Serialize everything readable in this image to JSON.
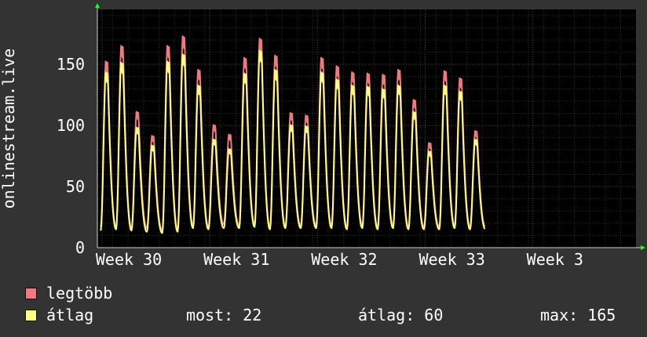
{
  "chart_data": {
    "type": "line",
    "ylabel": "onlinestream.live",
    "ylim": [
      0,
      195
    ],
    "yticks": [
      0,
      50,
      100,
      150
    ],
    "x_tick_labels": [
      "Week 30",
      "Week 31",
      "Week 32",
      "Week 33",
      "Week 3"
    ],
    "x_range_days": [
      0,
      35
    ],
    "grid": true,
    "series": [
      {
        "name": "legtöbb",
        "color": "#f07880",
        "daily_peaks": [
          155,
          168,
          113,
          93,
          168,
          176,
          148,
          102,
          94,
          158,
          174,
          160,
          112,
          110,
          158,
          151,
          146,
          145,
          144,
          148,
          123,
          87,
          147,
          141,
          97
        ],
        "daily_troughs": [
          17,
          17,
          16,
          16,
          14,
          15,
          18,
          17,
          19,
          18,
          19,
          17,
          18,
          18,
          18,
          18,
          17,
          18,
          17,
          18,
          17,
          17,
          17,
          18,
          17
        ]
      },
      {
        "name": "átlag",
        "color": "#ffff80",
        "daily_peaks": [
          146,
          154,
          100,
          85,
          155,
          161,
          135,
          90,
          82,
          145,
          164,
          148,
          102,
          101,
          146,
          140,
          135,
          134,
          132,
          135,
          113,
          80,
          135,
          130,
          90
        ],
        "daily_troughs": [
          14,
          15,
          14,
          13,
          12,
          13,
          16,
          15,
          16,
          16,
          17,
          15,
          16,
          16,
          16,
          16,
          15,
          16,
          15,
          16,
          15,
          15,
          15,
          16,
          15
        ]
      }
    ]
  },
  "legend": {
    "max_label": "legtöbb",
    "avg_label": "átlag",
    "max_color": "#f07880",
    "avg_color": "#ffff80"
  },
  "stats": {
    "now": "most: 22",
    "avg": "átlag: 60",
    "max": "max: 165"
  }
}
